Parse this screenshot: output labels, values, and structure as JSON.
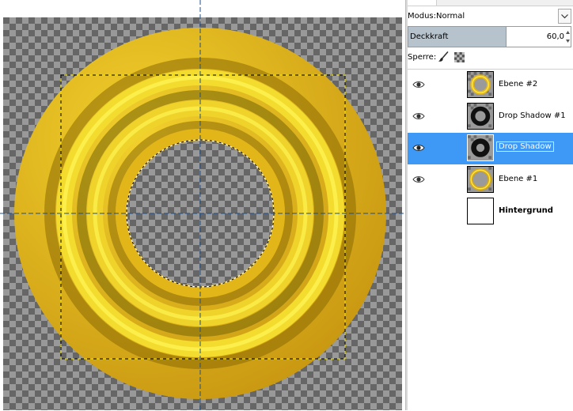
{
  "layers_panel": {
    "mode_label": "Modus:",
    "mode_value": "Normal",
    "opacity_label": "Deckkraft",
    "opacity_value": "60,0",
    "opacity_fraction": 0.6,
    "lock_label": "Sperre:",
    "layers": [
      {
        "name": "Ebene #2",
        "visible": true,
        "selected": false,
        "thumb": "ring-gold-small",
        "bold": false
      },
      {
        "name": "Drop Shadow #1",
        "visible": true,
        "selected": false,
        "thumb": "ring-black",
        "bold": false
      },
      {
        "name": "Drop Shadow",
        "visible": true,
        "selected": true,
        "thumb": "ring-black",
        "bold": false
      },
      {
        "name": "Ebene #1",
        "visible": true,
        "selected": false,
        "thumb": "ring-gold-large",
        "bold": false
      },
      {
        "name": "Hintergrund",
        "visible": false,
        "selected": false,
        "thumb": "white",
        "bold": true
      }
    ]
  },
  "colors": {
    "selection_highlight": "#3d99f5",
    "guide_line": "#1c4f8f",
    "gold_light": "#fff23a",
    "gold_mid": "#e1b516",
    "gold_dark": "#9a6a06",
    "checker_dark": "#999999",
    "checker_light": "#666666"
  }
}
